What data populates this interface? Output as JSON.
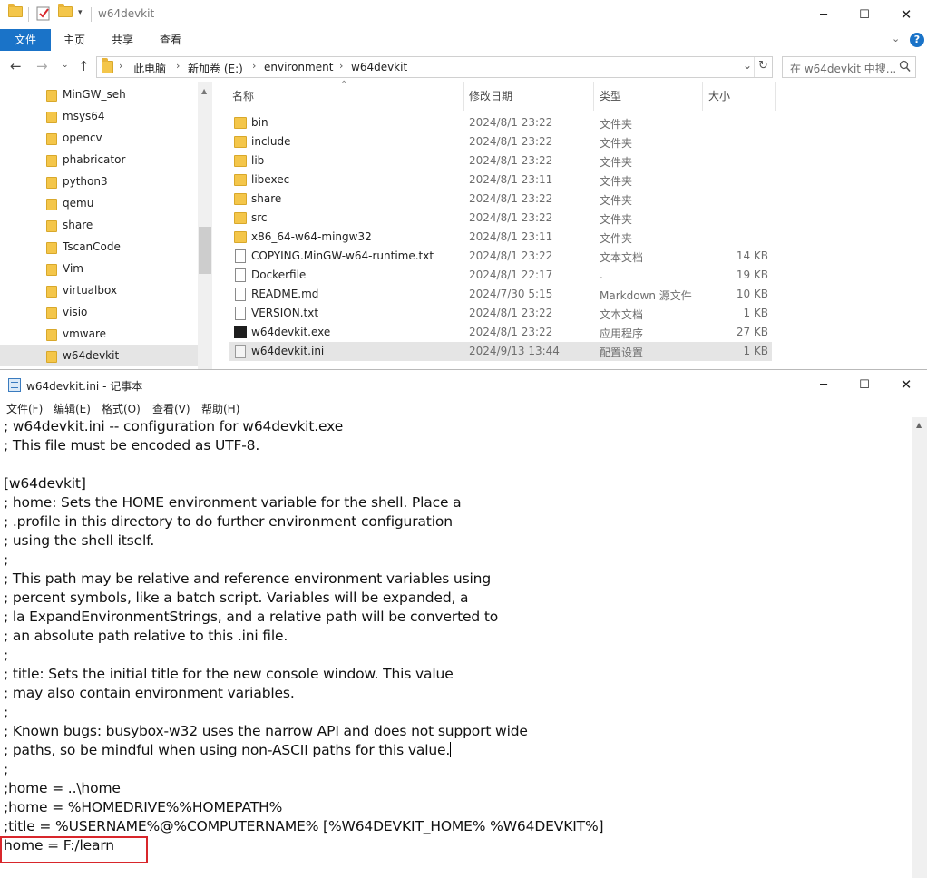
{
  "explorer": {
    "title": "w64devkit",
    "ribbon": [
      "文件",
      "主页",
      "共享",
      "查看"
    ],
    "breadcrumb": [
      "此电脑",
      "新加卷 (E:)",
      "environment",
      "w64devkit"
    ],
    "search_placeholder": "在 w64devkit 中搜...",
    "tree": [
      "MinGW_seh",
      "msys64",
      "opencv",
      "phabricator",
      "python3",
      "qemu",
      "share",
      "TscanCode",
      "Vim",
      "virtualbox",
      "visio",
      "vmware",
      "w64devkit"
    ],
    "columns": {
      "name": "名称",
      "date": "修改日期",
      "type": "类型",
      "size": "大小"
    },
    "files": [
      {
        "icon": "folder",
        "name": "bin",
        "date": "2024/8/1 23:22",
        "type": "文件夹",
        "size": ""
      },
      {
        "icon": "folder",
        "name": "include",
        "date": "2024/8/1 23:22",
        "type": "文件夹",
        "size": ""
      },
      {
        "icon": "folder",
        "name": "lib",
        "date": "2024/8/1 23:22",
        "type": "文件夹",
        "size": ""
      },
      {
        "icon": "folder",
        "name": "libexec",
        "date": "2024/8/1 23:11",
        "type": "文件夹",
        "size": ""
      },
      {
        "icon": "folder",
        "name": "share",
        "date": "2024/8/1 23:22",
        "type": "文件夹",
        "size": ""
      },
      {
        "icon": "folder",
        "name": "src",
        "date": "2024/8/1 23:22",
        "type": "文件夹",
        "size": ""
      },
      {
        "icon": "folder",
        "name": "x86_64-w64-mingw32",
        "date": "2024/8/1 23:11",
        "type": "文件夹",
        "size": ""
      },
      {
        "icon": "doc",
        "name": "COPYING.MinGW-w64-runtime.txt",
        "date": "2024/8/1 23:22",
        "type": "文本文档",
        "size": "14 KB"
      },
      {
        "icon": "doc",
        "name": "Dockerfile",
        "date": "2024/8/1 22:17",
        "type": ".",
        "size": "19 KB"
      },
      {
        "icon": "doc",
        "name": "README.md",
        "date": "2024/7/30 5:15",
        "type": "Markdown 源文件",
        "size": "10 KB"
      },
      {
        "icon": "doc",
        "name": "VERSION.txt",
        "date": "2024/8/1 23:22",
        "type": "文本文档",
        "size": "1 KB"
      },
      {
        "icon": "exe",
        "name": "w64devkit.exe",
        "date": "2024/8/1 23:22",
        "type": "应用程序",
        "size": "27 KB"
      },
      {
        "icon": "ini",
        "name": "w64devkit.ini",
        "date": "2024/9/13 13:44",
        "type": "配置设置",
        "size": "1 KB"
      }
    ]
  },
  "notepad": {
    "title": "w64devkit.ini - 记事本",
    "menu": [
      "文件(F)",
      "编辑(E)",
      "格式(O)",
      "查看(V)",
      "帮助(H)"
    ],
    "lines": [
      "; w64devkit.ini -- configuration for w64devkit.exe",
      "; This file must be encoded as UTF-8.",
      "",
      "[w64devkit]",
      "; home: Sets the HOME environment variable for the shell. Place a",
      "; .profile in this directory to do further environment configuration",
      "; using the shell itself.",
      ";",
      "; This path may be relative and reference environment variables using",
      "; percent symbols, like a batch script. Variables will be expanded, a",
      "; la ExpandEnvironmentStrings, and a relative path will be converted to",
      "; an absolute path relative to this .ini file.",
      ";",
      "; title: Sets the initial title for the new console window. This value",
      "; may also contain environment variables.",
      ";",
      "; Known bugs: busybox-w32 uses the narrow API and does not support wide",
      "; paths, so be mindful when using non-ASCII paths for this value.",
      ";",
      ";home = ..\\home",
      ";home = %HOMEDRIVE%%HOMEPATH%",
      ";title = %USERNAME%@%COMPUTERNAME% [%W64DEVKIT_HOME% %W64DEVKIT%]",
      "home = F:/learn"
    ]
  }
}
